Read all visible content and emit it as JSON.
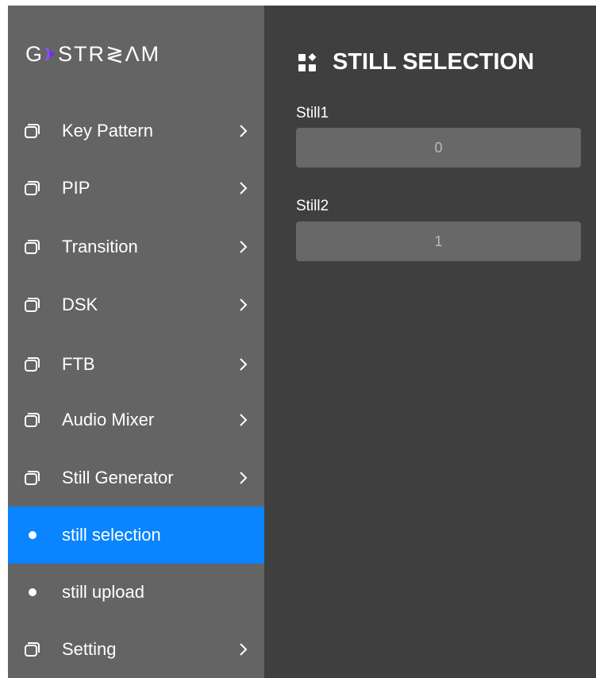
{
  "app": {
    "logo_text_left": "G",
    "logo_text_right": "STR≷ΛΜ",
    "brand_color": "#7b3fe4"
  },
  "sidebar": {
    "items": [
      {
        "label": "Key Pattern",
        "icon": "layers-icon",
        "has_chevron": true,
        "active": false
      },
      {
        "label": "PIP",
        "icon": "layers-icon",
        "has_chevron": true,
        "active": false
      },
      {
        "label": "Transition",
        "icon": "layers-icon",
        "has_chevron": true,
        "active": false
      },
      {
        "label": "DSK",
        "icon": "layers-icon",
        "has_chevron": true,
        "active": false
      },
      {
        "label": "FTB",
        "icon": "layers-icon",
        "has_chevron": true,
        "active": false
      },
      {
        "label": "Audio Mixer",
        "icon": "layers-icon",
        "has_chevron": true,
        "active": false
      },
      {
        "label": "Still Generator",
        "icon": "layers-icon",
        "has_chevron": true,
        "active": false
      },
      {
        "label": "still selection",
        "icon": "dot-icon",
        "has_chevron": false,
        "active": true
      },
      {
        "label": "still upload",
        "icon": "dot-icon",
        "has_chevron": false,
        "active": false
      },
      {
        "label": "Setting",
        "icon": "layers-icon",
        "has_chevron": true,
        "active": false
      }
    ],
    "active_color": "#0a84ff"
  },
  "main": {
    "title": "STILL SELECTION",
    "title_icon": "widgets-icon",
    "fields": [
      {
        "label": "Still1",
        "value": "0"
      },
      {
        "label": "Still2",
        "value": "1"
      }
    ]
  }
}
